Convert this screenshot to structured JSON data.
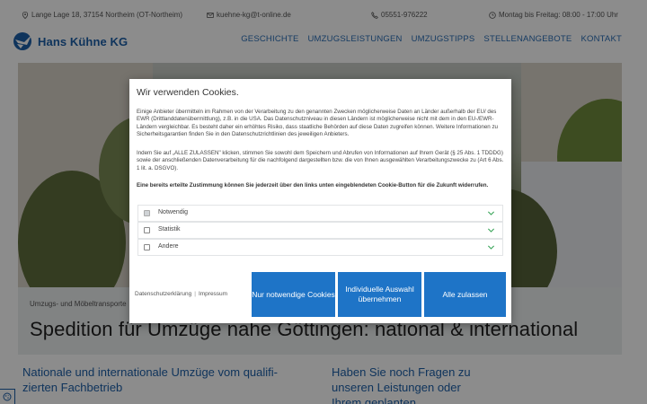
{
  "topbar": {
    "address": "Lange Lage 18, 37154 Northeim (OT-Northeim)",
    "email": "kuehne-kg@t-online.de",
    "phone": "05551-976222",
    "hours": "Montag bis Freitag: 08:00 - 17:00 Uhr"
  },
  "header": {
    "logo_text": "Hans Kühne KG",
    "nav": [
      "GESCHICHTE",
      "UMZUGSLEISTUNGEN",
      "UMZUGSTIPPS",
      "STELLENANGEBOTE",
      "KONTAKT"
    ]
  },
  "page": {
    "breadcrumb": "Umzugs- und Möbeltransporte",
    "headline": "Spedition für Umzüge nahe Göttingen: national & international",
    "section_left": "Nationale und internationale Umzüge vom qualifi-zierten Fachbetrieb",
    "section_right": "Haben Sie noch Fragen zu unseren Leistungen oder Ihrem geplanten"
  },
  "cookie": {
    "title": "Wir verwenden Cookies.",
    "paragraph1": "Einige Anbieter übermitteln im Rahmen von der Verarbeitung zu den genannten Zwecken möglicherweise Daten an Länder außerhalb der EU/ des EWR (Drittlanddatenübermittlung), z.B. in die USA. Das Datenschutzniveau in diesen Ländern ist möglicherweise nicht mit dem in den EU-/EWR-Ländern vergleichbar. Es besteht daher ein erhöhtes Risiko, dass staatliche Behörden auf diese Daten zugreifen können. Weitere Informationen zu Sicherheitsgarantien finden Sie in den Datenschutzrichtlinien des jeweiligen Anbieters.",
    "paragraph2": "Indem Sie auf „ALLE ZULASSEN\" klicken, stimmen Sie sowohl dem Speichern und Abrufen von Informationen auf Ihrem Gerät (§ 25 Abs. 1 TDDDG) sowie der anschließenden Datenverarbeitung für die nachfolgend dargestellten bzw. die von Ihnen ausgewählten Verarbeitungszwecke zu (Art 6 Abs. 1 lit. a. DSGVO).",
    "paragraph3": "Eine bereits erteilte Zustimmung können Sie jederzeit über den links unten eingeblendeten Cookie-Button für die Zukunft widerrufen.",
    "categories": [
      {
        "label": "Notwendig",
        "checked": true
      },
      {
        "label": "Statistik",
        "checked": false
      },
      {
        "label": "Andere",
        "checked": false
      }
    ],
    "link_privacy": "Datenschutzerklärung",
    "link_separator": "|",
    "link_imprint": "Impressum",
    "btn_necessary": "Nur notwendige Cookies",
    "btn_individual": "Individuelle Auswahl übernehmen",
    "btn_all": "Alle zulassen"
  },
  "colors": {
    "brand_blue": "#1d5fa8",
    "button_blue": "#1e74c7",
    "overlay": "rgba(0,0,0,0.45)"
  },
  "icons": [
    "location-icon",
    "mail-icon",
    "phone-icon",
    "clock-icon",
    "logo-icon",
    "chevron-down-icon",
    "cookie-settings-icon"
  ]
}
